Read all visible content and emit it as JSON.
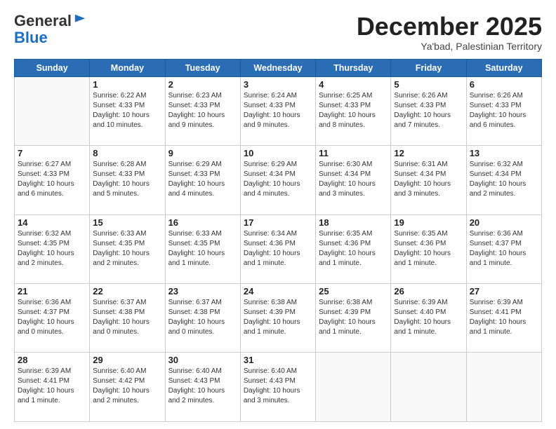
{
  "header": {
    "logo_general": "General",
    "logo_blue": "Blue",
    "month_title": "December 2025",
    "location": "Ya'bad, Palestinian Territory"
  },
  "weekdays": [
    "Sunday",
    "Monday",
    "Tuesday",
    "Wednesday",
    "Thursday",
    "Friday",
    "Saturday"
  ],
  "weeks": [
    [
      {
        "day": "",
        "info": ""
      },
      {
        "day": "1",
        "info": "Sunrise: 6:22 AM\nSunset: 4:33 PM\nDaylight: 10 hours\nand 10 minutes."
      },
      {
        "day": "2",
        "info": "Sunrise: 6:23 AM\nSunset: 4:33 PM\nDaylight: 10 hours\nand 9 minutes."
      },
      {
        "day": "3",
        "info": "Sunrise: 6:24 AM\nSunset: 4:33 PM\nDaylight: 10 hours\nand 9 minutes."
      },
      {
        "day": "4",
        "info": "Sunrise: 6:25 AM\nSunset: 4:33 PM\nDaylight: 10 hours\nand 8 minutes."
      },
      {
        "day": "5",
        "info": "Sunrise: 6:26 AM\nSunset: 4:33 PM\nDaylight: 10 hours\nand 7 minutes."
      },
      {
        "day": "6",
        "info": "Sunrise: 6:26 AM\nSunset: 4:33 PM\nDaylight: 10 hours\nand 6 minutes."
      }
    ],
    [
      {
        "day": "7",
        "info": "Sunrise: 6:27 AM\nSunset: 4:33 PM\nDaylight: 10 hours\nand 6 minutes."
      },
      {
        "day": "8",
        "info": "Sunrise: 6:28 AM\nSunset: 4:33 PM\nDaylight: 10 hours\nand 5 minutes."
      },
      {
        "day": "9",
        "info": "Sunrise: 6:29 AM\nSunset: 4:33 PM\nDaylight: 10 hours\nand 4 minutes."
      },
      {
        "day": "10",
        "info": "Sunrise: 6:29 AM\nSunset: 4:34 PM\nDaylight: 10 hours\nand 4 minutes."
      },
      {
        "day": "11",
        "info": "Sunrise: 6:30 AM\nSunset: 4:34 PM\nDaylight: 10 hours\nand 3 minutes."
      },
      {
        "day": "12",
        "info": "Sunrise: 6:31 AM\nSunset: 4:34 PM\nDaylight: 10 hours\nand 3 minutes."
      },
      {
        "day": "13",
        "info": "Sunrise: 6:32 AM\nSunset: 4:34 PM\nDaylight: 10 hours\nand 2 minutes."
      }
    ],
    [
      {
        "day": "14",
        "info": "Sunrise: 6:32 AM\nSunset: 4:35 PM\nDaylight: 10 hours\nand 2 minutes."
      },
      {
        "day": "15",
        "info": "Sunrise: 6:33 AM\nSunset: 4:35 PM\nDaylight: 10 hours\nand 2 minutes."
      },
      {
        "day": "16",
        "info": "Sunrise: 6:33 AM\nSunset: 4:35 PM\nDaylight: 10 hours\nand 1 minute."
      },
      {
        "day": "17",
        "info": "Sunrise: 6:34 AM\nSunset: 4:36 PM\nDaylight: 10 hours\nand 1 minute."
      },
      {
        "day": "18",
        "info": "Sunrise: 6:35 AM\nSunset: 4:36 PM\nDaylight: 10 hours\nand 1 minute."
      },
      {
        "day": "19",
        "info": "Sunrise: 6:35 AM\nSunset: 4:36 PM\nDaylight: 10 hours\nand 1 minute."
      },
      {
        "day": "20",
        "info": "Sunrise: 6:36 AM\nSunset: 4:37 PM\nDaylight: 10 hours\nand 1 minute."
      }
    ],
    [
      {
        "day": "21",
        "info": "Sunrise: 6:36 AM\nSunset: 4:37 PM\nDaylight: 10 hours\nand 0 minutes."
      },
      {
        "day": "22",
        "info": "Sunrise: 6:37 AM\nSunset: 4:38 PM\nDaylight: 10 hours\nand 0 minutes."
      },
      {
        "day": "23",
        "info": "Sunrise: 6:37 AM\nSunset: 4:38 PM\nDaylight: 10 hours\nand 0 minutes."
      },
      {
        "day": "24",
        "info": "Sunrise: 6:38 AM\nSunset: 4:39 PM\nDaylight: 10 hours\nand 1 minute."
      },
      {
        "day": "25",
        "info": "Sunrise: 6:38 AM\nSunset: 4:39 PM\nDaylight: 10 hours\nand 1 minute."
      },
      {
        "day": "26",
        "info": "Sunrise: 6:39 AM\nSunset: 4:40 PM\nDaylight: 10 hours\nand 1 minute."
      },
      {
        "day": "27",
        "info": "Sunrise: 6:39 AM\nSunset: 4:41 PM\nDaylight: 10 hours\nand 1 minute."
      }
    ],
    [
      {
        "day": "28",
        "info": "Sunrise: 6:39 AM\nSunset: 4:41 PM\nDaylight: 10 hours\nand 1 minute."
      },
      {
        "day": "29",
        "info": "Sunrise: 6:40 AM\nSunset: 4:42 PM\nDaylight: 10 hours\nand 2 minutes."
      },
      {
        "day": "30",
        "info": "Sunrise: 6:40 AM\nSunset: 4:43 PM\nDaylight: 10 hours\nand 2 minutes."
      },
      {
        "day": "31",
        "info": "Sunrise: 6:40 AM\nSunset: 4:43 PM\nDaylight: 10 hours\nand 3 minutes."
      },
      {
        "day": "",
        "info": ""
      },
      {
        "day": "",
        "info": ""
      },
      {
        "day": "",
        "info": ""
      }
    ]
  ]
}
